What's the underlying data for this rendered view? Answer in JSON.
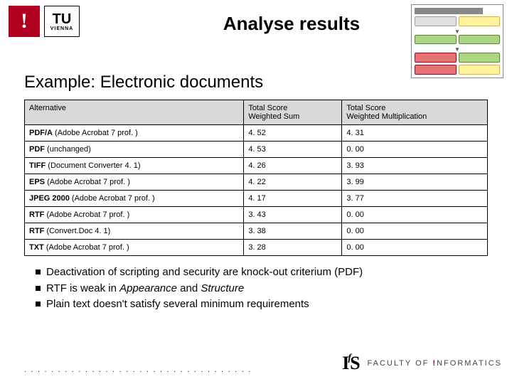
{
  "header": {
    "title": "Analyse results",
    "logo_exclaim": "!",
    "logo_tu_top": "TU",
    "logo_tu_bot": "VIENNA"
  },
  "subtitle": "Example: Electronic documents",
  "table": {
    "head": {
      "c0": "Alternative",
      "c1a": "Total Score",
      "c1b": "Weighted Sum",
      "c2a": "Total Score",
      "c2b": "Weighted Multiplication"
    },
    "rows": [
      {
        "pref": "PDF/A",
        "suf": " (Adobe Acrobat 7 prof. )",
        "ws": "4. 52",
        "wm": "4. 31"
      },
      {
        "pref": "PDF",
        "suf": " (unchanged)",
        "ws": "4. 53",
        "wm": "0. 00"
      },
      {
        "pref": "TIFF",
        "suf": " (Document Converter 4. 1)",
        "ws": "4. 26",
        "wm": "3. 93"
      },
      {
        "pref": "EPS",
        "suf": " (Adobe Acrobat 7 prof. )",
        "ws": "4. 22",
        "wm": "3. 99"
      },
      {
        "pref": "JPEG 2000",
        "suf": " (Adobe Acrobat 7 prof. )",
        "ws": "4. 17",
        "wm": "3. 77"
      },
      {
        "pref": "RTF",
        "suf": " (Adobe Acrobat 7 prof. )",
        "ws": "3. 43",
        "wm": "0. 00"
      },
      {
        "pref": "RTF",
        "suf": " (Convert.Doc 4. 1)",
        "ws": "3. 38",
        "wm": "0. 00"
      },
      {
        "pref": "TXT",
        "suf": " (Adobe Acrobat 7 prof. )",
        "ws": "3. 28",
        "wm": "0. 00"
      }
    ]
  },
  "bullets": {
    "b0a": "Deactivation of scripting and security are knock-out criterium (PDF)",
    "b1a": "RTF is weak in ",
    "b1b": "Appearance",
    "b1c": " and ",
    "b1d": "Structure",
    "b2a": "Plain text doesn't satisfy several minimum requirements"
  },
  "footer": {
    "dots": ". . . . . . . . . . . . . . . . . . . . . . . . . . . . . . . . . .",
    "logo_text": "IfS",
    "fac_a": "FACULTY  OF  ",
    "fac_ex": "!",
    "fac_b": "NFORMATICS"
  }
}
